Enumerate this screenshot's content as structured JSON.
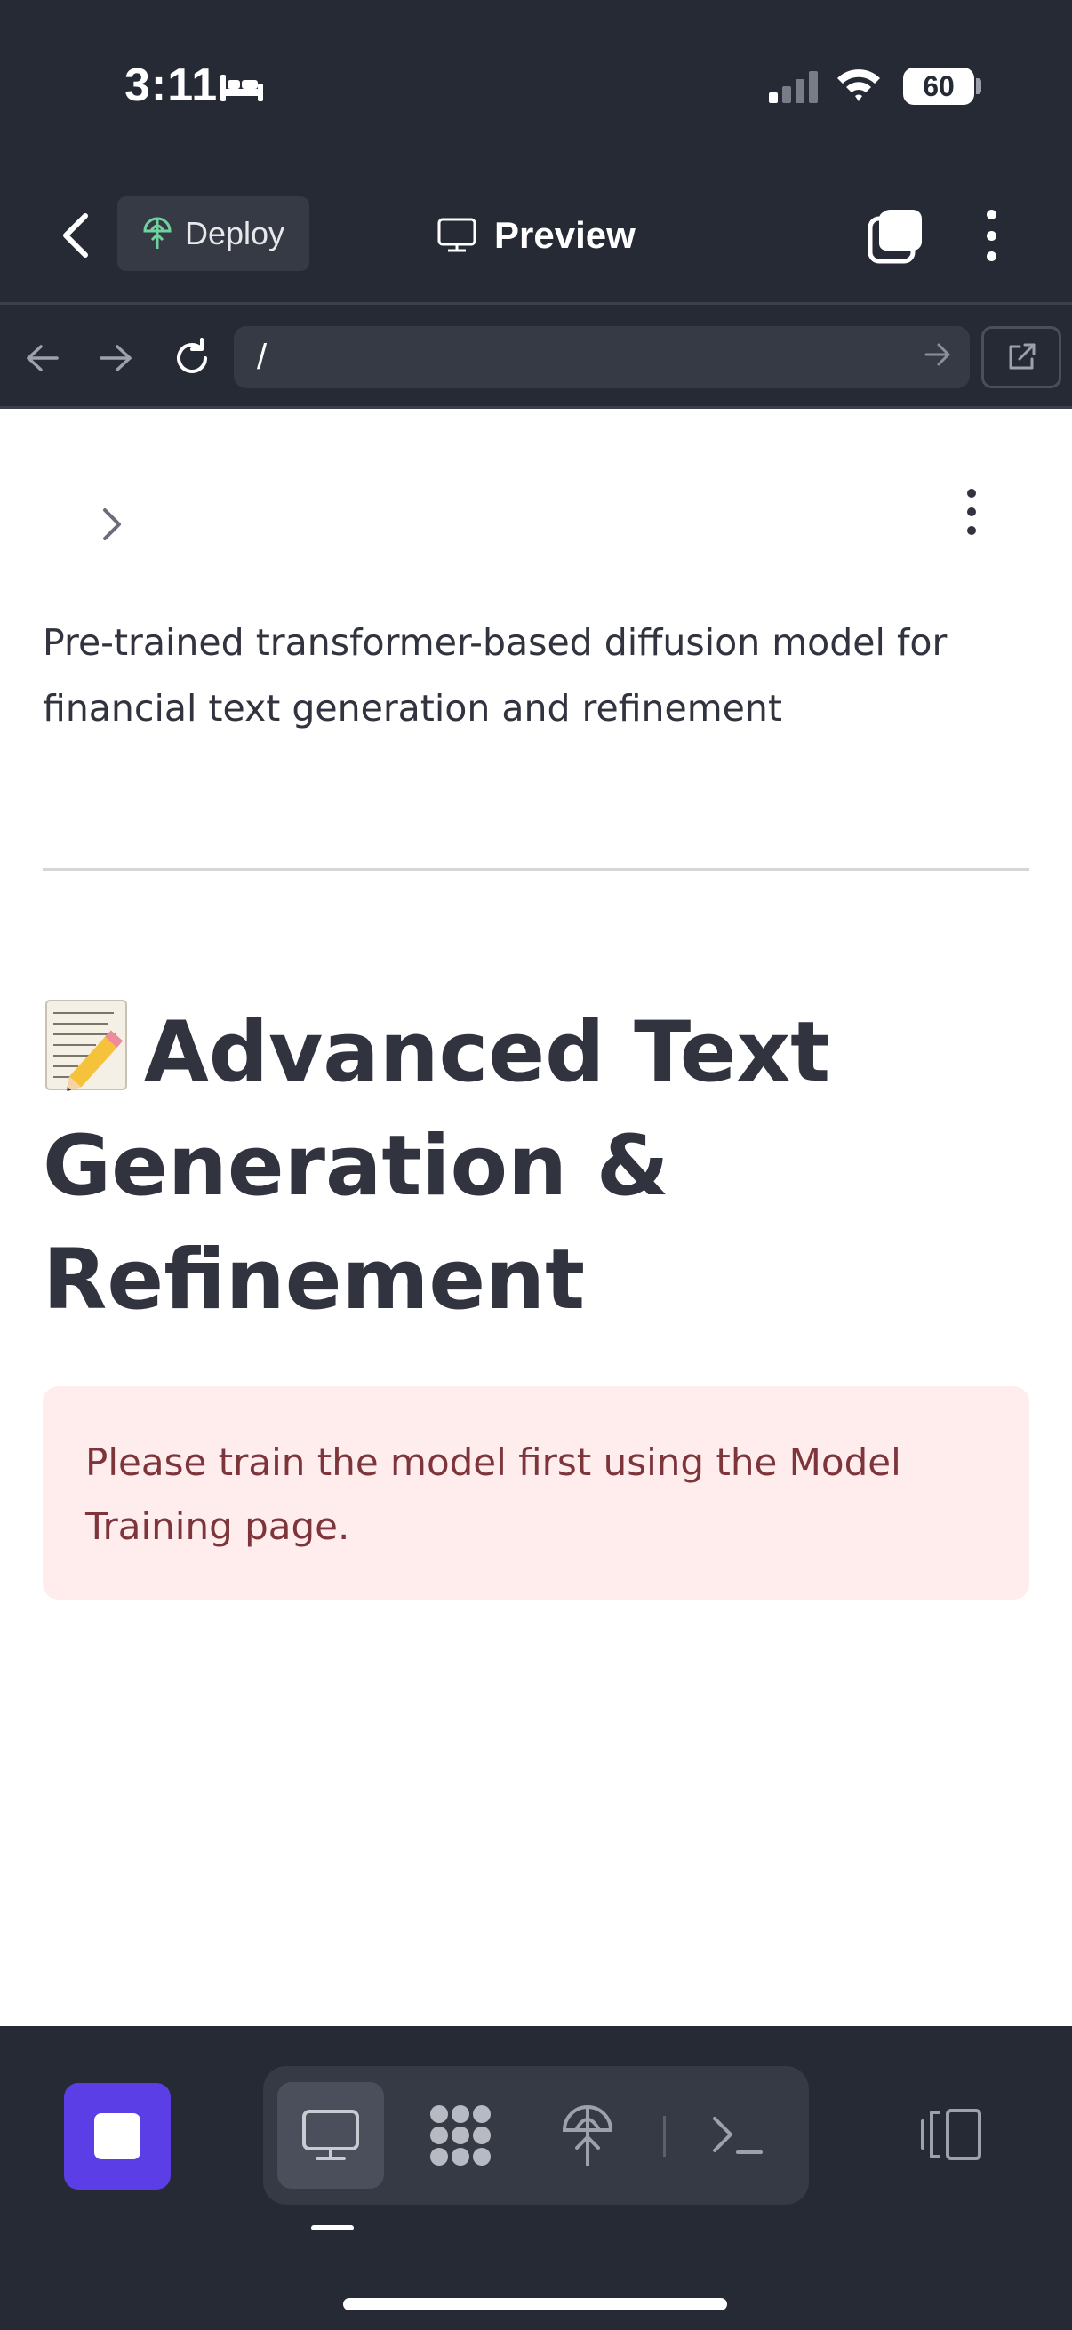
{
  "status_bar": {
    "time": "3:11",
    "battery": "60"
  },
  "header": {
    "deploy_label": "Deploy",
    "preview_label": "Preview"
  },
  "url_bar": {
    "url": "/"
  },
  "content": {
    "subtitle": "Pre-trained transformer-based diffusion model for financial text generation and refinement",
    "heading": "Advanced Text Generation & Refinement",
    "alert_text": "Please train the model first using the Model Training page."
  },
  "colors": {
    "accent": "#5b3ee6",
    "alert_bg": "#ffecec",
    "alert_text": "#7d353b",
    "deploy_icon": "#6fd3a0"
  },
  "icons": {
    "header": [
      "back-chevron-icon",
      "deploy-icon",
      "monitor-icon",
      "tabs-icon",
      "more-vertical-icon"
    ],
    "url_bar": [
      "arrow-left-icon",
      "arrow-right-icon",
      "reload-icon",
      "go-arrow-icon",
      "external-link-icon"
    ],
    "toolbar": [
      "stop-icon",
      "monitor-icon",
      "apps-grid-icon",
      "deploy-icon",
      "terminal-icon",
      "layout-panels-icon"
    ]
  }
}
